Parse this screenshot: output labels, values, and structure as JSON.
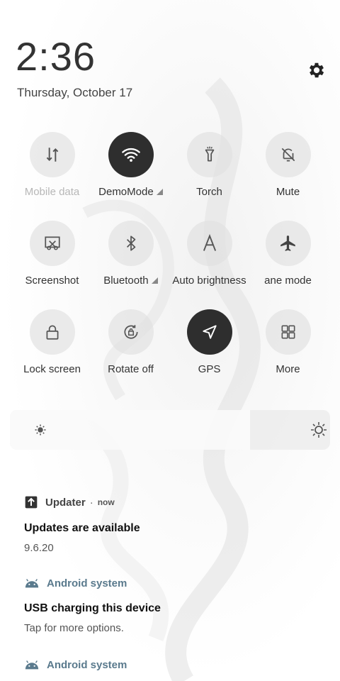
{
  "status": {
    "time": "2:36",
    "date": "Thursday, October 17"
  },
  "settings_icon": "gear-icon",
  "tiles": [
    {
      "label": "Mobile data",
      "icon": "mobile-data-icon",
      "active": false
    },
    {
      "label": "DemoMode",
      "icon": "wifi-icon",
      "active": true
    },
    {
      "label": "Torch",
      "icon": "flashlight-icon",
      "active": false
    },
    {
      "label": "Mute",
      "icon": "bell-off-icon",
      "active": false
    },
    {
      "label": "Screenshot",
      "icon": "screenshot-icon",
      "active": false
    },
    {
      "label": "Bluetooth",
      "icon": "bluetooth-icon",
      "active": false
    },
    {
      "label": "Auto brightness",
      "icon": "auto-brightness-icon",
      "active": false
    },
    {
      "label": "ane mode",
      "icon": "airplane-icon",
      "active": false
    },
    {
      "label": "Lock screen",
      "icon": "lock-icon",
      "active": false
    },
    {
      "label": "Rotate off",
      "icon": "rotate-lock-icon",
      "active": false
    },
    {
      "label": "GPS",
      "icon": "location-arrow-icon",
      "active": true
    },
    {
      "label": "More",
      "icon": "grid-icon",
      "active": false
    }
  ],
  "brightness": {
    "level": 0.75
  },
  "notifications": [
    {
      "app": "Updater",
      "time": "now",
      "title": "Updates are available",
      "body": "9.6.20"
    },
    {
      "app": "Android system",
      "title": "USB charging this device",
      "body": "Tap for more options."
    },
    {
      "app": "Android system"
    }
  ],
  "colors": {
    "active_tile": "#2e2e2e",
    "android_app": "#5a7a8d",
    "inactive_tile": "#e1e1e1"
  }
}
